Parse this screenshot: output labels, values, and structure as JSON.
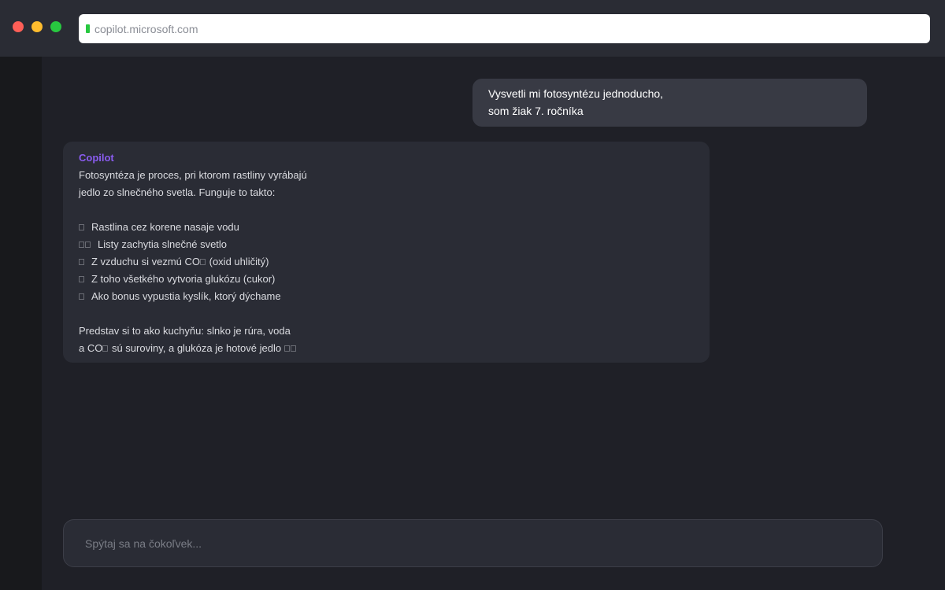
{
  "browser": {
    "url": "copilot.microsoft.com"
  },
  "conversation": {
    "user_message": {
      "lines": [
        "Vysvetli mi fotosyntézu jednoducho,",
        "som žiak 7. ročníka"
      ]
    },
    "assistant_message": {
      "sender": "Copilot",
      "intro_lines": [
        "Fotosyntéza je proces, pri ktorom rastliny vyrábajú",
        "jedlo zo slnečného svetla. Funguje to takto:"
      ],
      "steps": [
        "Rastlina cez korene nasaje vodu",
        "Listy zachytia slnečné svetlo",
        "Z vzduchu si vezmú CO",
        "Z toho všetkého vytvoria glukózu (cukor)",
        "Ako bonus vypustia kyslík, ktorý dýchame"
      ],
      "step3_suffix": "(oxid uhličitý)",
      "outro_line1": "Predstav si to ako kuchyňu: slnko je rúra, voda",
      "outro_line2_a": "a CO",
      "outro_line2_b": "sú suroviny, a glukóza je hotové jedlo"
    }
  },
  "composer": {
    "placeholder": "Spýtaj sa na čokoľvek..."
  },
  "colors": {
    "accent": "#8a5cf0",
    "background": "#1f2027"
  }
}
